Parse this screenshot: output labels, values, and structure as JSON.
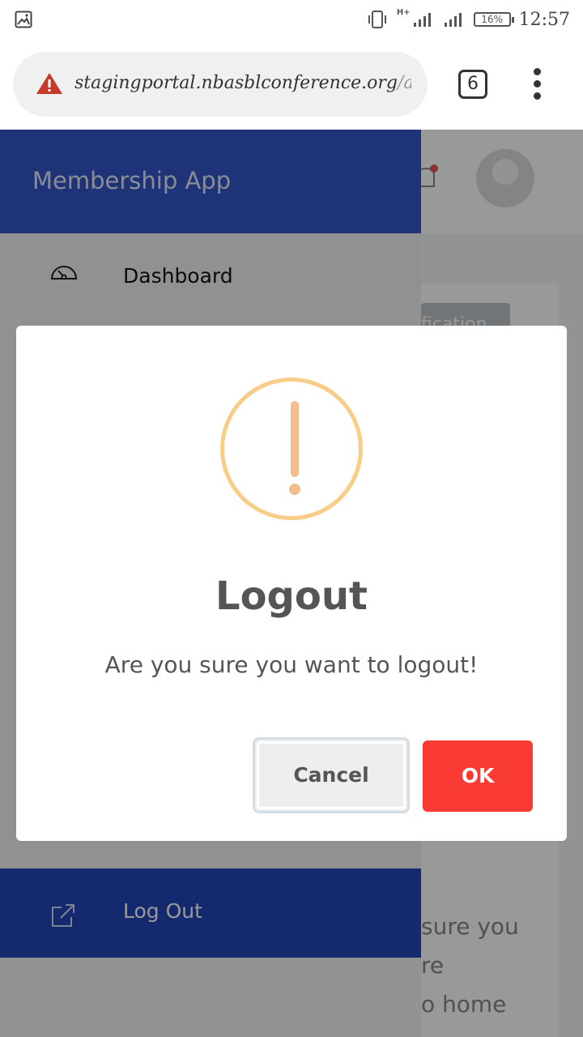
{
  "status_bar": {
    "network": "H+",
    "battery": "16%",
    "time": "12:57"
  },
  "browser": {
    "url_main": "stagingportal.nbasblconference.org",
    "url_rest": "/acce",
    "tab_count": "6"
  },
  "app": {
    "background_chip_partial": "fication",
    "background_text_lines": [
      "sure you",
      "re",
      "o home"
    ]
  },
  "drawer": {
    "title": "Membership App",
    "items": [
      {
        "label": "Dashboard",
        "icon": "speedometer-icon"
      },
      {
        "label": "Log Out",
        "icon": "external-link-icon"
      }
    ]
  },
  "dialog": {
    "icon": "warning-icon",
    "title": "Logout",
    "message": "Are you sure you want to logout!",
    "cancel_label": "Cancel",
    "ok_label": "OK"
  },
  "colors": {
    "drawer_header": "#3457c9",
    "drawer_logout": "#2345b8",
    "ok_button": "#fa3b33",
    "warning_ring": "#f8cd88"
  }
}
